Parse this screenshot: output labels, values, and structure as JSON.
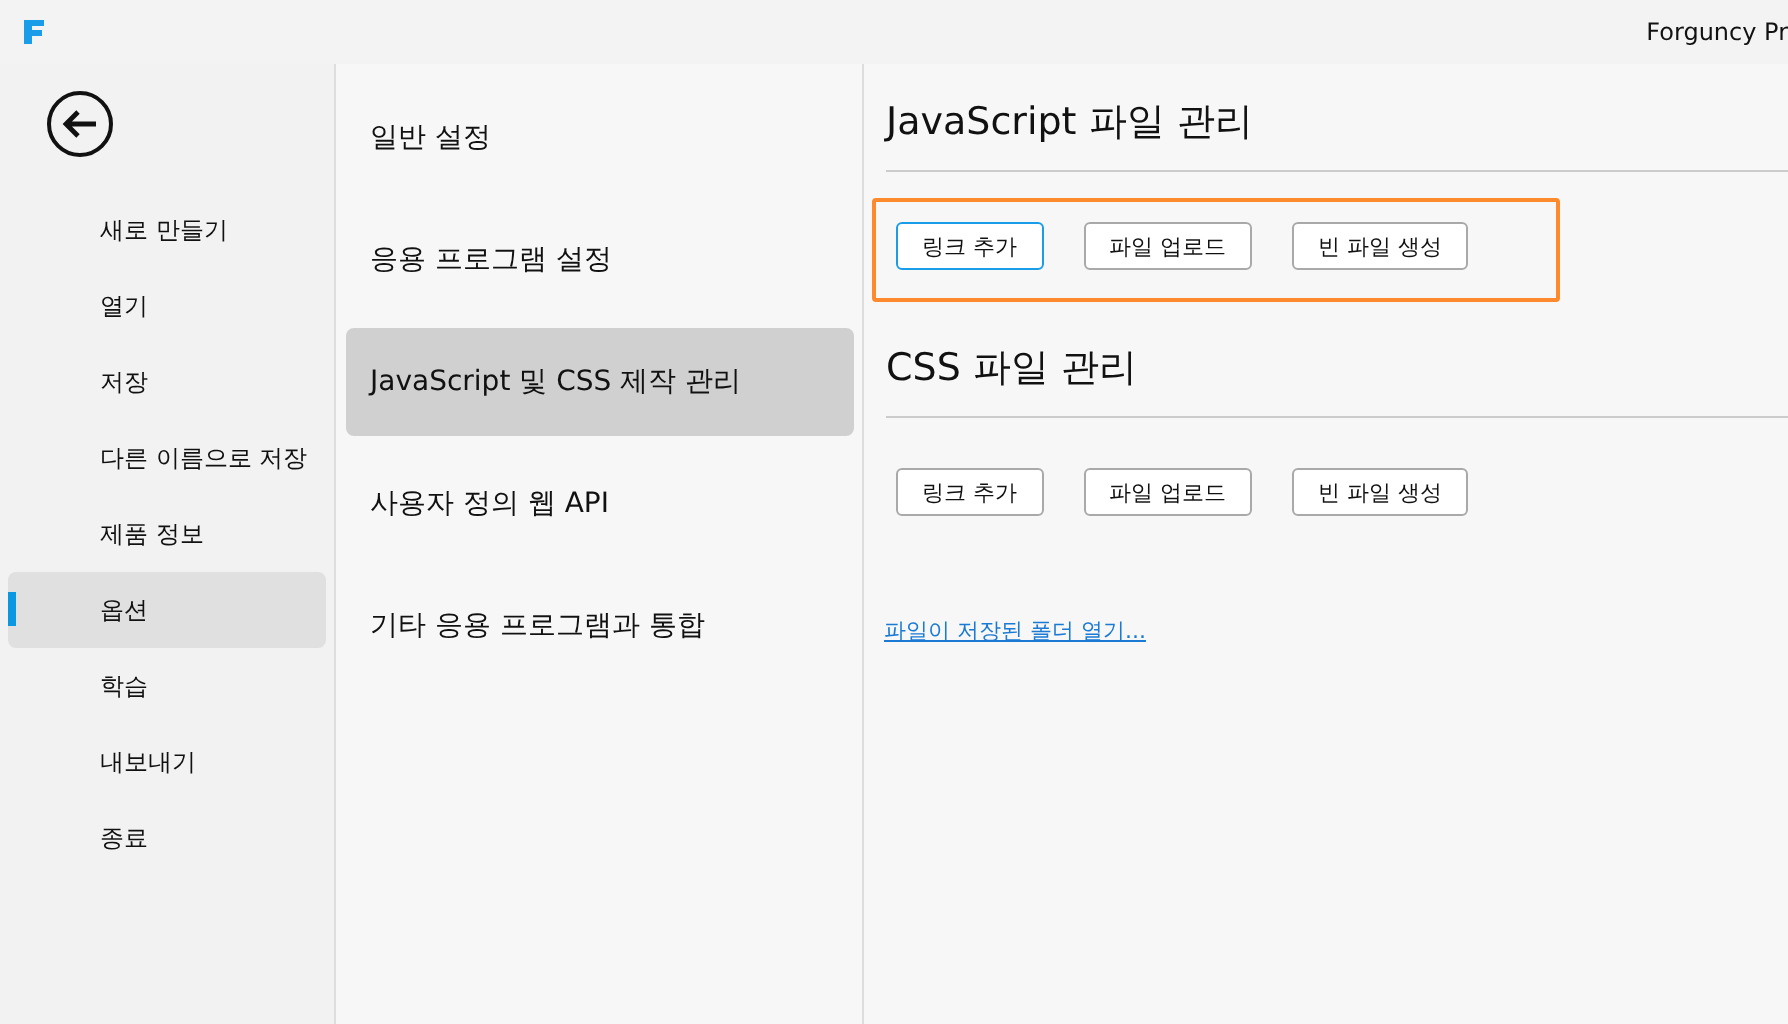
{
  "window": {
    "title": "Forguncy Pr"
  },
  "sidebar": {
    "items": [
      {
        "label": "새로 만들기",
        "selected": false
      },
      {
        "label": "열기",
        "selected": false
      },
      {
        "label": "저장",
        "selected": false
      },
      {
        "label": "다른 이름으로 저장",
        "selected": false
      },
      {
        "label": "제품 정보",
        "selected": false
      },
      {
        "label": "옵션",
        "selected": true
      },
      {
        "label": "학습",
        "selected": false
      },
      {
        "label": "내보내기",
        "selected": false
      },
      {
        "label": "종료",
        "selected": false
      }
    ]
  },
  "categories": [
    {
      "label": "일반 설정",
      "selected": false
    },
    {
      "label": "응용 프로그램 설정",
      "selected": false
    },
    {
      "label": "JavaScript 및 CSS 제작 관리",
      "selected": true
    },
    {
      "label": "사용자 정의 웹 API",
      "selected": false
    },
    {
      "label": "기타 응용 프로그램과 통합",
      "selected": false
    }
  ],
  "sections": [
    {
      "title": "JavaScript 파일 관리",
      "highlighted": true,
      "buttons": [
        {
          "label": "링크 추가",
          "focused": true
        },
        {
          "label": "파일 업로드",
          "focused": false
        },
        {
          "label": "빈 파일 생성",
          "focused": false
        }
      ]
    },
    {
      "title": "CSS 파일 관리",
      "highlighted": false,
      "buttons": [
        {
          "label": "링크 추가",
          "focused": false
        },
        {
          "label": "파일 업로드",
          "focused": false
        },
        {
          "label": "빈 파일 생성",
          "focused": false
        }
      ]
    }
  ],
  "link": "파일이 저장된 폴더 열기..."
}
